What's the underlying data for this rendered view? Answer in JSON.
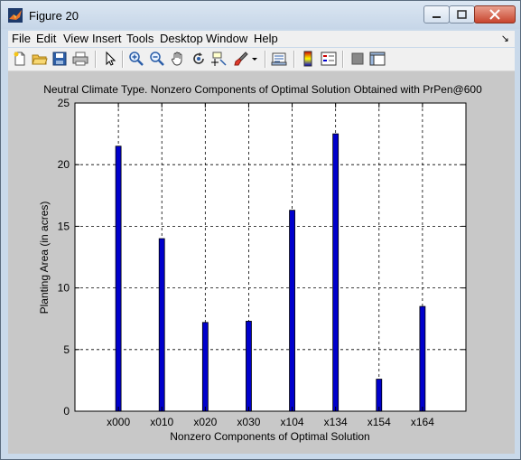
{
  "window": {
    "title": "Figure 20"
  },
  "menu": [
    "File",
    "Edit",
    "View",
    "Insert",
    "Tools",
    "Desktop",
    "Window",
    "Help"
  ],
  "toolbar_icons": [
    "new-file-icon",
    "open-folder-icon",
    "save-icon",
    "print-icon",
    "pointer-icon",
    "zoom-in-icon",
    "zoom-out-icon",
    "pan-hand-icon",
    "rotate-3d-icon",
    "data-cursor-icon",
    "brush-icon",
    "brush-dropdown-icon",
    "link-plot-icon",
    "colorbar-icon",
    "legend-icon",
    "hide-plot-tools-icon",
    "show-plot-tools-icon"
  ],
  "chart_data": {
    "type": "bar",
    "title": "Neutral Climate Type. Nonzero Components of Optimal Solution Obtained with PrPen@600",
    "xlabel": "Nonzero Components of Optimal Solution",
    "ylabel": "Planting Area (in acres)",
    "categories": [
      "x000",
      "x010",
      "x020",
      "x030",
      "x104",
      "x134",
      "x154",
      "x164"
    ],
    "values": [
      21.5,
      14.0,
      7.2,
      7.3,
      16.3,
      22.5,
      2.6,
      8.5
    ],
    "ylim": [
      0,
      25
    ],
    "yticks": [
      "0",
      "5",
      "10",
      "15",
      "20",
      "25"
    ],
    "grid": true,
    "bar_color": "#0000cc"
  }
}
